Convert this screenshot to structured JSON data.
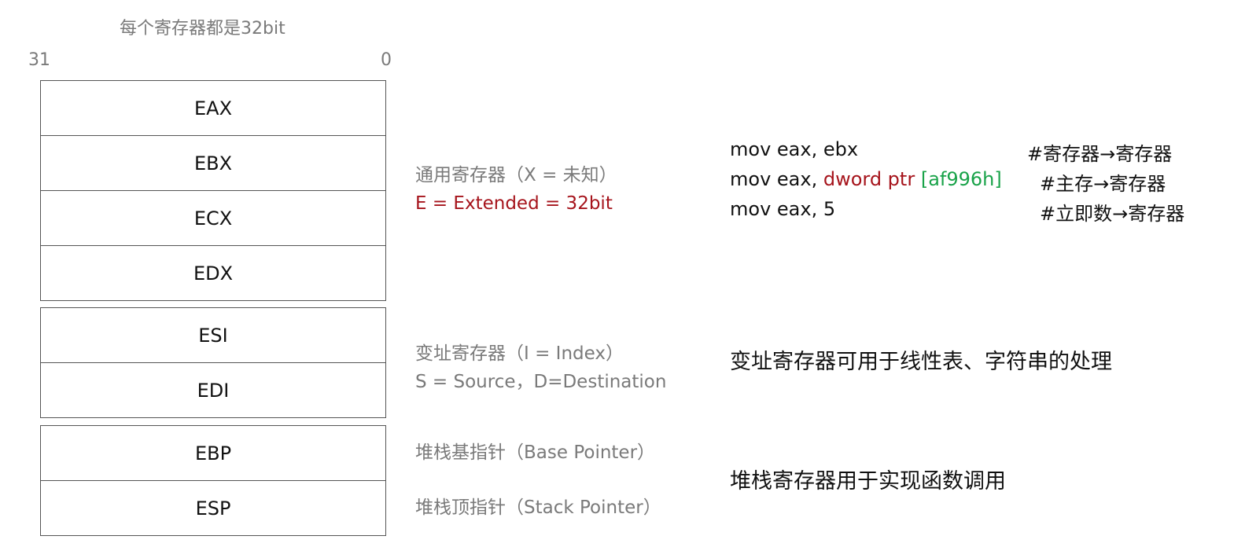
{
  "header": "每个寄存器都是32bit",
  "bit_high": "31",
  "bit_low": "0",
  "groups": [
    {
      "registers": [
        "EAX",
        "EBX",
        "ECX",
        "EDX"
      ]
    },
    {
      "registers": [
        "ESI",
        "EDI"
      ]
    },
    {
      "registers": [
        "EBP",
        "ESP"
      ]
    }
  ],
  "descriptions": {
    "general": {
      "line1": "通用寄存器（X = 未知）",
      "line2": "E = Extended = 32bit"
    },
    "index": {
      "line1": "变址寄存器（I = Index）",
      "line2": "S = Source，D=Destination"
    },
    "ebp": "堆栈基指针（Base Pointer）",
    "esp": "堆栈顶指针（Stack Pointer）"
  },
  "code": {
    "line1": {
      "instr": "mov eax, ebx",
      "comment": "#寄存器→寄存器"
    },
    "line2": {
      "instr_prefix": "mov eax, ",
      "ptr": "dword ptr",
      "addr": "[af996h]",
      "comment": "#主存→寄存器"
    },
    "line3": {
      "instr": "mov eax, 5",
      "comment": "#立即数→寄存器"
    }
  },
  "notes": {
    "index": "变址寄存器可用于线性表、字符串的处理",
    "stack": "堆栈寄存器用于实现函数调用"
  },
  "colors": {
    "red": "#a6141c",
    "green": "#1aa34a",
    "gray": "#7a7a7a",
    "border": "#555555"
  }
}
